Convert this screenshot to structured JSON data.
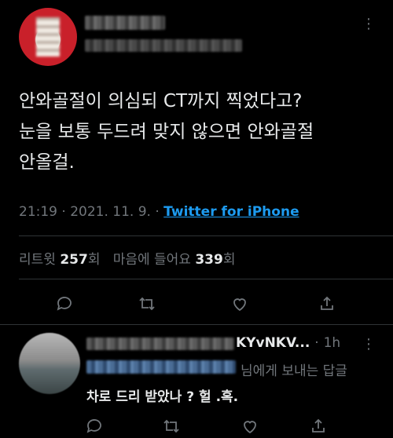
{
  "tweet": {
    "author_name": "",
    "author_handle": "",
    "text": "안와골절이 의심되 CT까지 찍었다고?\n눈을 보통 두드려 맞지 않으면 안와골절\n안올걸.",
    "time": "21:19",
    "date": "2021. 11. 9.",
    "separator": "·",
    "client": "Twitter for iPhone",
    "retweets_label": "리트윗",
    "retweets_count": "257",
    "retweets_unit": "회",
    "likes_label": "마음에 들어요",
    "likes_count": "339",
    "likes_unit": "회",
    "more_icon": "⋮"
  },
  "actions": [
    "reply-icon",
    "retweet-icon",
    "like-icon",
    "share-icon"
  ],
  "reply": {
    "name_visible": "KYvNKV...",
    "separator": "·",
    "time": "1h",
    "more_icon": "⋮",
    "replying_suffix": "님에게 보내는 답글",
    "text": "차로 드리 받았나 ? 헐 .혹."
  },
  "colors": {
    "link": "#1d9bf0",
    "muted": "#71767b",
    "text": "#e7e9ea",
    "background": "#000000"
  }
}
